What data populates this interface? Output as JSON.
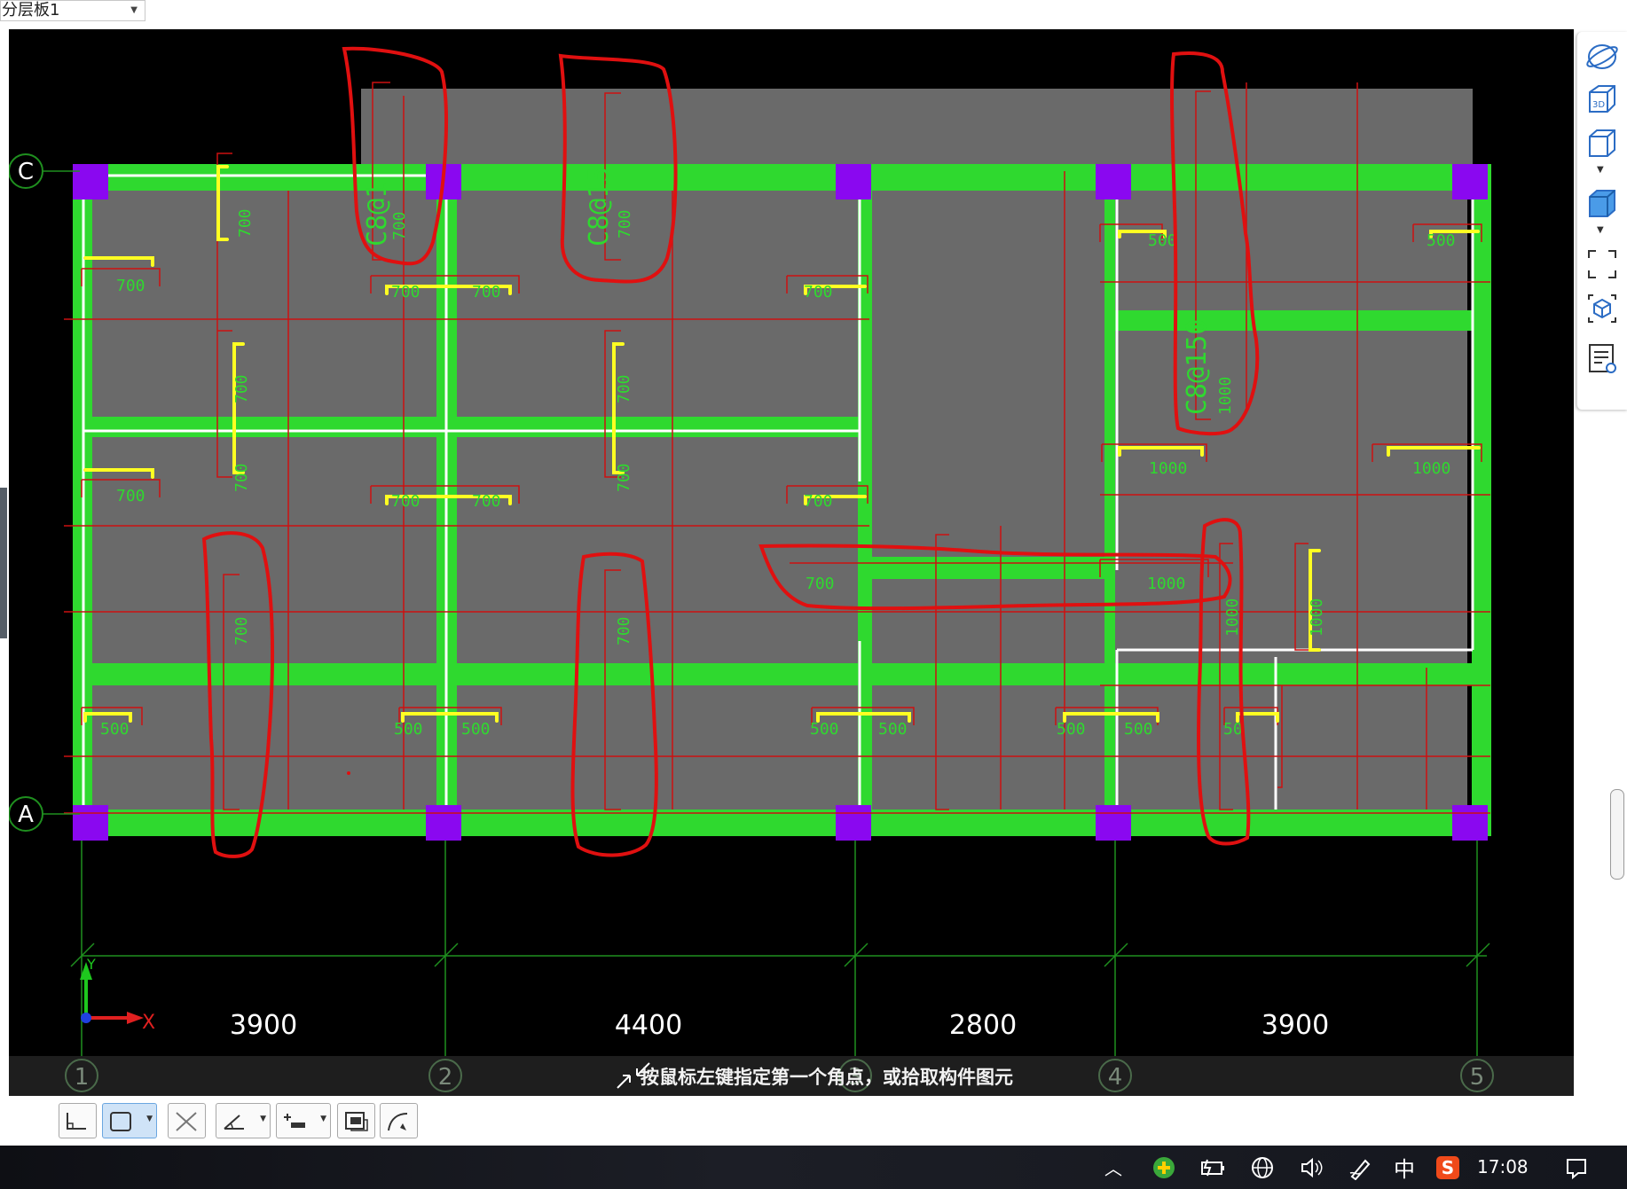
{
  "layer_select": {
    "value": "分层板1"
  },
  "axes": {
    "rows": [
      "C",
      "A"
    ],
    "cols": [
      "1",
      "2",
      "3",
      "4",
      "5"
    ],
    "spans": [
      "3900",
      "4400",
      "2800",
      "3900"
    ]
  },
  "ucs": {
    "x": "X",
    "y": "Y"
  },
  "rebar_annotations": {
    "c8at150": "C8@150",
    "c8at15": "C8@15",
    "c8at1_partial": "C8@1",
    "v700": "700",
    "v500": "500",
    "v1000": "1000",
    "v50_partial": "50",
    "v500_partial": "500"
  },
  "status": {
    "prompt": "按鼠标左键指定第一个角点，或拾取构件图元"
  },
  "right_toolbar": {
    "items": [
      "orbit-icon",
      "3d-view-icon",
      "box-view-icon",
      "solid-box-icon",
      "fit-view-icon",
      "component-cube-icon",
      "property-list-icon"
    ]
  },
  "bottom_toolbar": {
    "items": [
      "orthogonal-icon",
      "rectangle-select-icon",
      "cross-select-icon",
      "angle-snap-icon",
      "insert-point-icon",
      "display-icon",
      "arc-icon"
    ]
  },
  "taskbar": {
    "time": "17:08",
    "ime": "中",
    "sogou": "S"
  },
  "colors": {
    "canvas": "#000000",
    "slab_fill": "#6a6a6a",
    "beam": "#2fd92f",
    "column": "#8a08f0",
    "rebar": "#ffff22",
    "dim_line": "#cc1111",
    "markup": "#e01010",
    "grid_text": "#2fd92f"
  }
}
